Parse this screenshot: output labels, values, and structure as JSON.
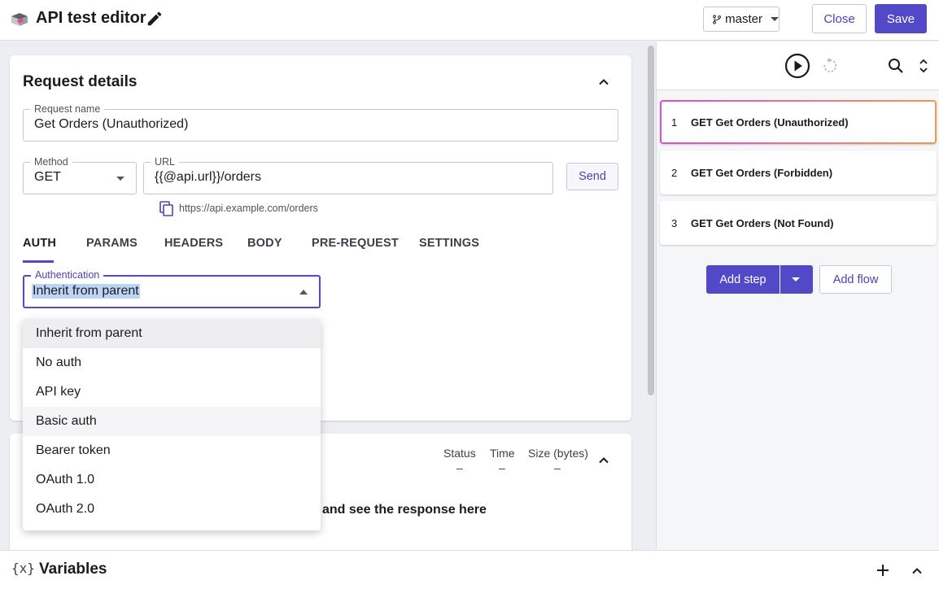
{
  "header": {
    "title": "API test editor",
    "branch": "master",
    "close_label": "Close",
    "save_label": "Save"
  },
  "request": {
    "section_title": "Request details",
    "name_label": "Request name",
    "name_value": "Get Orders (Unauthorized)",
    "method_label": "Method",
    "method_value": "GET",
    "url_label": "URL",
    "url_value": "{{@api.url}}/orders",
    "send_label": "Send",
    "resolved_url": "https://api.example.com/orders"
  },
  "tabs": [
    "AUTH",
    "PARAMS",
    "HEADERS",
    "BODY",
    "PRE-REQUEST",
    "SETTINGS"
  ],
  "auth": {
    "label": "Authentication",
    "value": "Inherit from parent",
    "options": [
      "Inherit from parent",
      "No auth",
      "API key",
      "Basic auth",
      "Bearer token",
      "OAuth 1.0",
      "OAuth 2.0"
    ]
  },
  "response": {
    "status_label": "Status",
    "status_value": "–",
    "time_label": "Time",
    "time_value": "–",
    "size_label": "Size (bytes)",
    "size_value": "–",
    "empty_message": "on and see the response here"
  },
  "steps": [
    {
      "num": "1",
      "label": "GET Get Orders (Unauthorized)"
    },
    {
      "num": "2",
      "label": "GET Get Orders (Forbidden)"
    },
    {
      "num": "3",
      "label": "GET Get Orders (Not Found)"
    }
  ],
  "right_actions": {
    "add_step": "Add step",
    "add_flow": "Add flow"
  },
  "bottom": {
    "variables_icon": "{x}",
    "variables_title": "Variables"
  },
  "colors": {
    "accent": "#5249c8",
    "active_step_gradient": [
      "#d84fd8",
      "#f19a4b"
    ]
  }
}
